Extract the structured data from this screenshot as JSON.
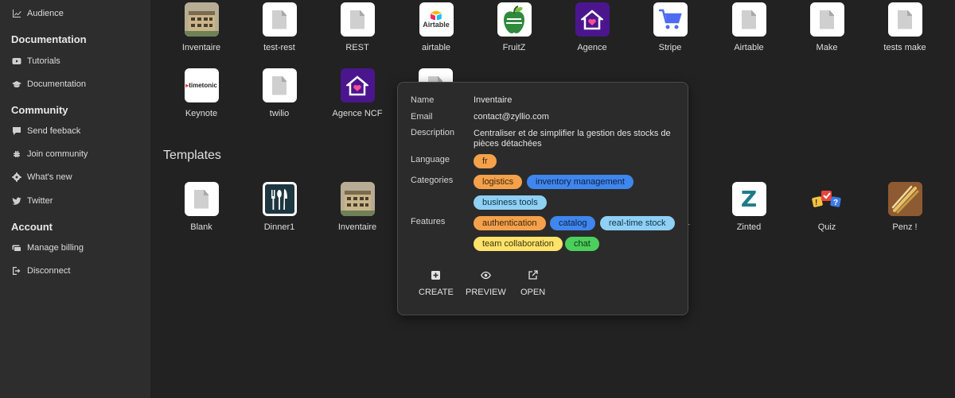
{
  "sidebar": {
    "items_top": [
      {
        "label": "Audience",
        "icon": "chart-line-icon"
      }
    ],
    "sections": [
      {
        "title": "Documentation",
        "items": [
          {
            "label": "Tutorials",
            "icon": "youtube-icon"
          },
          {
            "label": "Documentation",
            "icon": "graduation-cap-icon"
          }
        ]
      },
      {
        "title": "Community",
        "items": [
          {
            "label": "Send feeback",
            "icon": "comment-icon"
          },
          {
            "label": "Join community",
            "icon": "slack-icon"
          },
          {
            "label": "What's new",
            "icon": "gear-icon"
          },
          {
            "label": "Twitter",
            "icon": "twitter-icon"
          }
        ]
      },
      {
        "title": "Account",
        "items": [
          {
            "label": "Manage billing",
            "icon": "billing-icon"
          },
          {
            "label": "Disconnect",
            "icon": "logout-icon"
          }
        ]
      }
    ]
  },
  "apps": [
    {
      "label": "Inventaire",
      "icon": "warehouse-icon"
    },
    {
      "label": "test-rest",
      "icon": "document-icon"
    },
    {
      "label": "REST",
      "icon": "document-icon"
    },
    {
      "label": "airtable",
      "icon": "airtable-logo-icon",
      "logo_text": "Airtable"
    },
    {
      "label": "FruitZ",
      "icon": "apple-icon"
    },
    {
      "label": "Agence",
      "icon": "house-heart-icon"
    },
    {
      "label": "Stripe",
      "icon": "cart-icon"
    },
    {
      "label": "Airtable",
      "icon": "document-icon"
    },
    {
      "label": "Make",
      "icon": "document-icon"
    },
    {
      "label": "tests make",
      "icon": "document-icon"
    },
    {
      "label": "Keynote",
      "icon": "timetonic-logo-icon",
      "logo_text": "timetonic"
    },
    {
      "label": "twilio",
      "icon": "document-icon"
    },
    {
      "label": "Agence NCF",
      "icon": "house-heart-icon"
    }
  ],
  "templates_title": "Templates",
  "templates": [
    {
      "label": "Blank",
      "icon": "document-icon"
    },
    {
      "label": "Dinner1",
      "icon": "cutlery-icon"
    },
    {
      "label": "Inventaire",
      "icon": "warehouse-icon"
    },
    {
      "label": "r",
      "icon": "hidden-icon"
    },
    {
      "label": "Zinted",
      "icon": "z-logo-icon",
      "logo_text": "Z"
    },
    {
      "label": "Quiz",
      "icon": "quiz-icon"
    },
    {
      "label": "Penz !",
      "icon": "pens-icon"
    }
  ],
  "popup": {
    "name_label": "Name",
    "name": "Inventaire",
    "email_label": "Email",
    "email": "contact@zyllio.com",
    "description_label": "Description",
    "description_line1": "Centraliser et de simplifier la gestion des stocks de",
    "description_line2": "pièces détachées",
    "language_label": "Language",
    "language": "fr",
    "categories_label": "Categories",
    "categories": [
      "logistics",
      "inventory management",
      "business tools"
    ],
    "features_label": "Features",
    "features": [
      "authentication",
      "catalog",
      "real-time stock",
      "team collaboration",
      "chat"
    ],
    "actions": [
      {
        "label": "CREATE",
        "icon": "plus-square-icon"
      },
      {
        "label": "PREVIEW",
        "icon": "eye-icon"
      },
      {
        "label": "OPEN",
        "icon": "external-link-icon"
      }
    ]
  },
  "colors": {
    "orange": "#f5a04a",
    "blue": "#3f86ee",
    "lightblue": "#8fd0f5",
    "yellow": "#ffe26a",
    "green": "#4ccf5c",
    "purple": "#4b168d",
    "stripe": "#4f6cf0"
  }
}
